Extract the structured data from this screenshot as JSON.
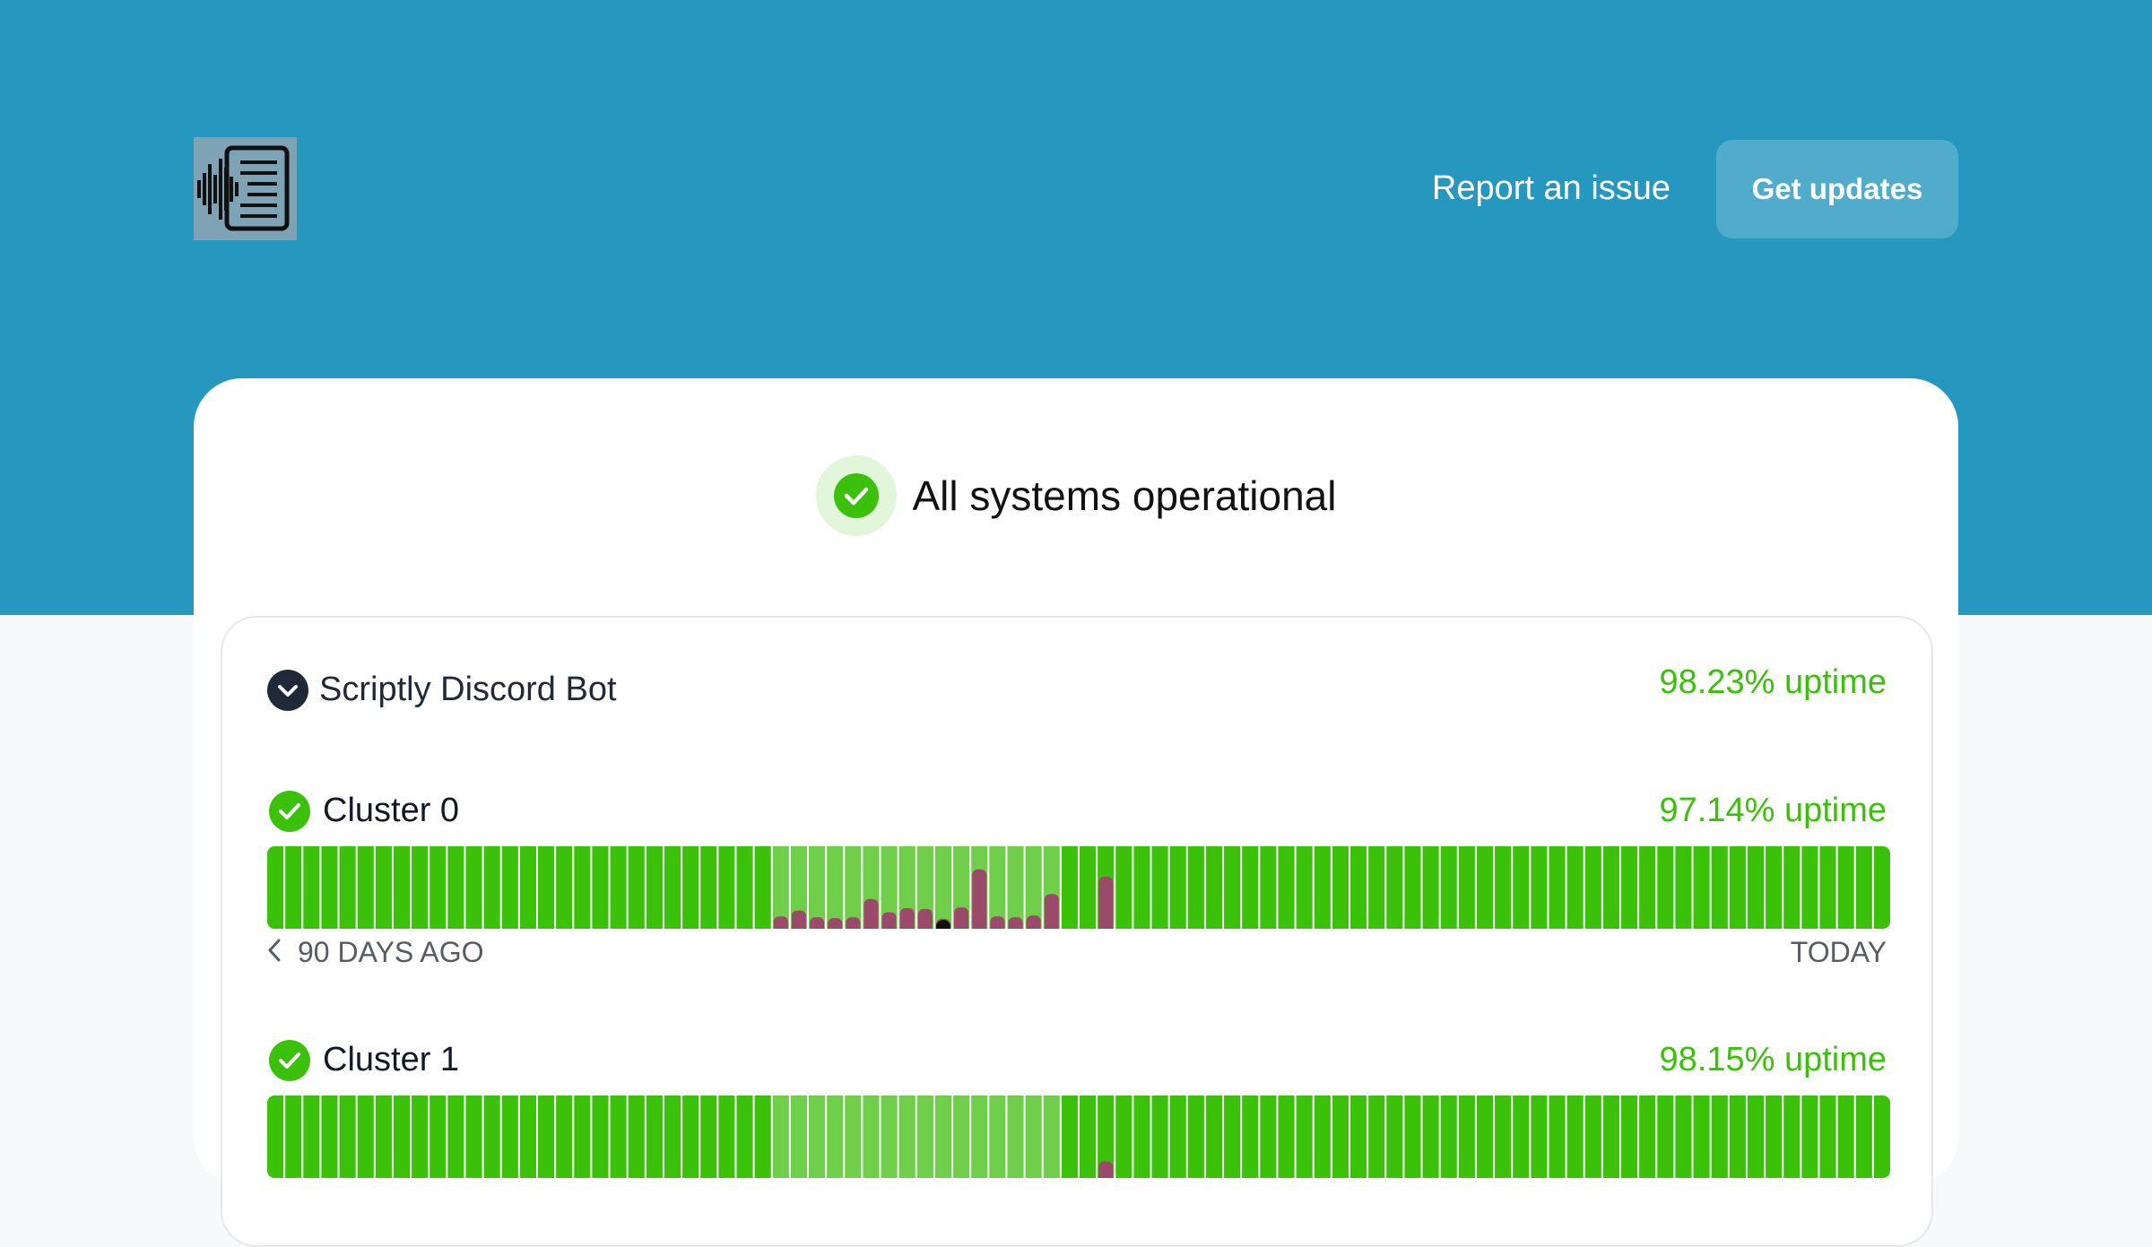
{
  "header": {
    "logo_name": "scriptly-logo",
    "report_link": "Report an issue",
    "updates_button": "Get updates"
  },
  "status": {
    "overall": "All systems operational",
    "icon": "check-circle-icon"
  },
  "colors": {
    "hero": "#2697bf",
    "operational": "#3cc10b",
    "light_operational": "#6fcf4a",
    "incident": "#9b4a6a",
    "outage": "#111111"
  },
  "group": {
    "name": "Scriptly Discord Bot",
    "uptime": "98.23% uptime",
    "toggle_icon": "chevron-down-icon"
  },
  "components": [
    {
      "name": "Cluster 0",
      "uptime": "97.14% uptime",
      "range_start": "90 DAYS AGO",
      "range_end": "TODAY",
      "bars": [
        0,
        0,
        0,
        0,
        0,
        0,
        0,
        0,
        0,
        0,
        0,
        0,
        0,
        0,
        0,
        0,
        0,
        0,
        0,
        0,
        0,
        0,
        0,
        0,
        0,
        0,
        0,
        0,
        0.15,
        0.22,
        0.14,
        0.13,
        0.14,
        0.36,
        0.2,
        0.25,
        0.24,
        0.12,
        0.26,
        0.72,
        0.15,
        0.14,
        0.16,
        0.42,
        0,
        0,
        0.63,
        0,
        0,
        0,
        0,
        0,
        0,
        0,
        0,
        0,
        0,
        0,
        0,
        0,
        0,
        0,
        0,
        0,
        0,
        0,
        0,
        0,
        0,
        0,
        0,
        0,
        0,
        0,
        0,
        0,
        0,
        0,
        0,
        0,
        0,
        0,
        0,
        0,
        0,
        0,
        0,
        0,
        0,
        0
      ],
      "light_days": [
        28,
        43
      ],
      "outage_days": [
        37
      ]
    },
    {
      "name": "Cluster 1",
      "uptime": "98.15% uptime",
      "bars": [
        0,
        0,
        0,
        0,
        0,
        0,
        0,
        0,
        0,
        0,
        0,
        0,
        0,
        0,
        0,
        0,
        0,
        0,
        0,
        0,
        0,
        0,
        0,
        0,
        0,
        0,
        0,
        0,
        0,
        0,
        0,
        0,
        0,
        0,
        0,
        0,
        0,
        0,
        0,
        0,
        0,
        0,
        0,
        0,
        0,
        0,
        0.2,
        0,
        0,
        0,
        0,
        0,
        0,
        0,
        0,
        0,
        0,
        0,
        0,
        0,
        0,
        0,
        0,
        0,
        0,
        0,
        0,
        0,
        0,
        0,
        0,
        0,
        0,
        0,
        0,
        0,
        0,
        0,
        0,
        0,
        0,
        0,
        0,
        0,
        0,
        0,
        0,
        0,
        0,
        0
      ],
      "light_days": [
        28,
        43
      ],
      "outage_days": []
    }
  ]
}
